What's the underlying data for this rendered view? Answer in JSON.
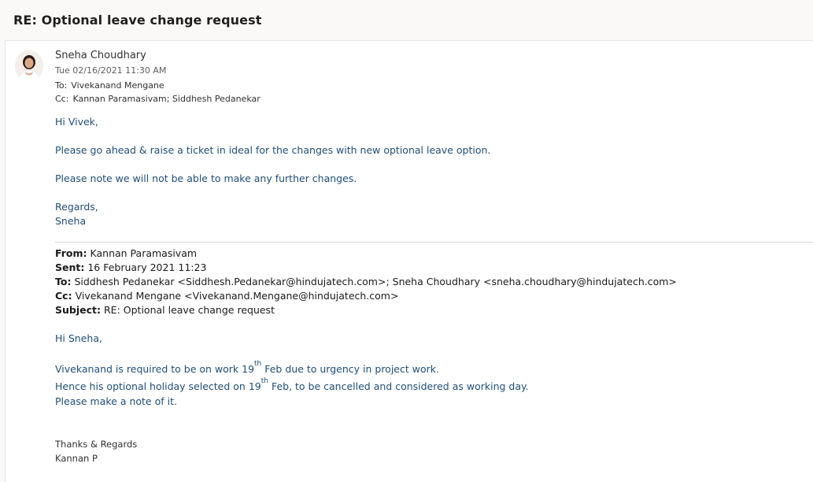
{
  "subject": "RE: Optional leave change request",
  "message": {
    "sender": "Sneha Choudhary",
    "date": "Tue 02/16/2021 11:30 AM",
    "to_label": "To:",
    "to": "Vivekanand Mengane",
    "cc_label": "Cc:",
    "cc": "Kannan Paramasivam; Siddhesh Pedanekar",
    "body": {
      "greeting": "Hi Vivek,",
      "line1": "Please go ahead & raise a ticket in ideal for the changes with new optional leave option.",
      "line2": "Please note we will not be able to make any further changes.",
      "closing": "Regards,",
      "name": "Sneha"
    }
  },
  "quoted": {
    "from_label": "From:",
    "from": "Kannan Paramasivam",
    "sent_label": "Sent:",
    "sent": "16 February 2021 11:23",
    "to_label": "To:",
    "to": "Siddhesh Pedanekar <Siddhesh.Pedanekar@hindujatech.com>; Sneha Choudhary <sneha.choudhary@hindujatech.com>",
    "cc_label": "Cc:",
    "cc": "Vivekanand Mengane <Vivekanand.Mengane@hindujatech.com>",
    "subject_label": "Subject:",
    "subject": "RE: Optional leave change request",
    "body": {
      "greeting": "Hi Sneha,",
      "line1_a": "Vivekanand is required to be on work 19",
      "line1_sup": "th",
      "line1_b": " Feb due to urgency in project work.",
      "line2_a": "Hence his optional holiday selected on 19",
      "line2_sup": "th",
      "line2_b": " Feb, to be cancelled and considered as working day.",
      "line3": "Please make a note of it.",
      "sign1": "Thanks & Regards",
      "sign2": "Kannan P"
    }
  }
}
